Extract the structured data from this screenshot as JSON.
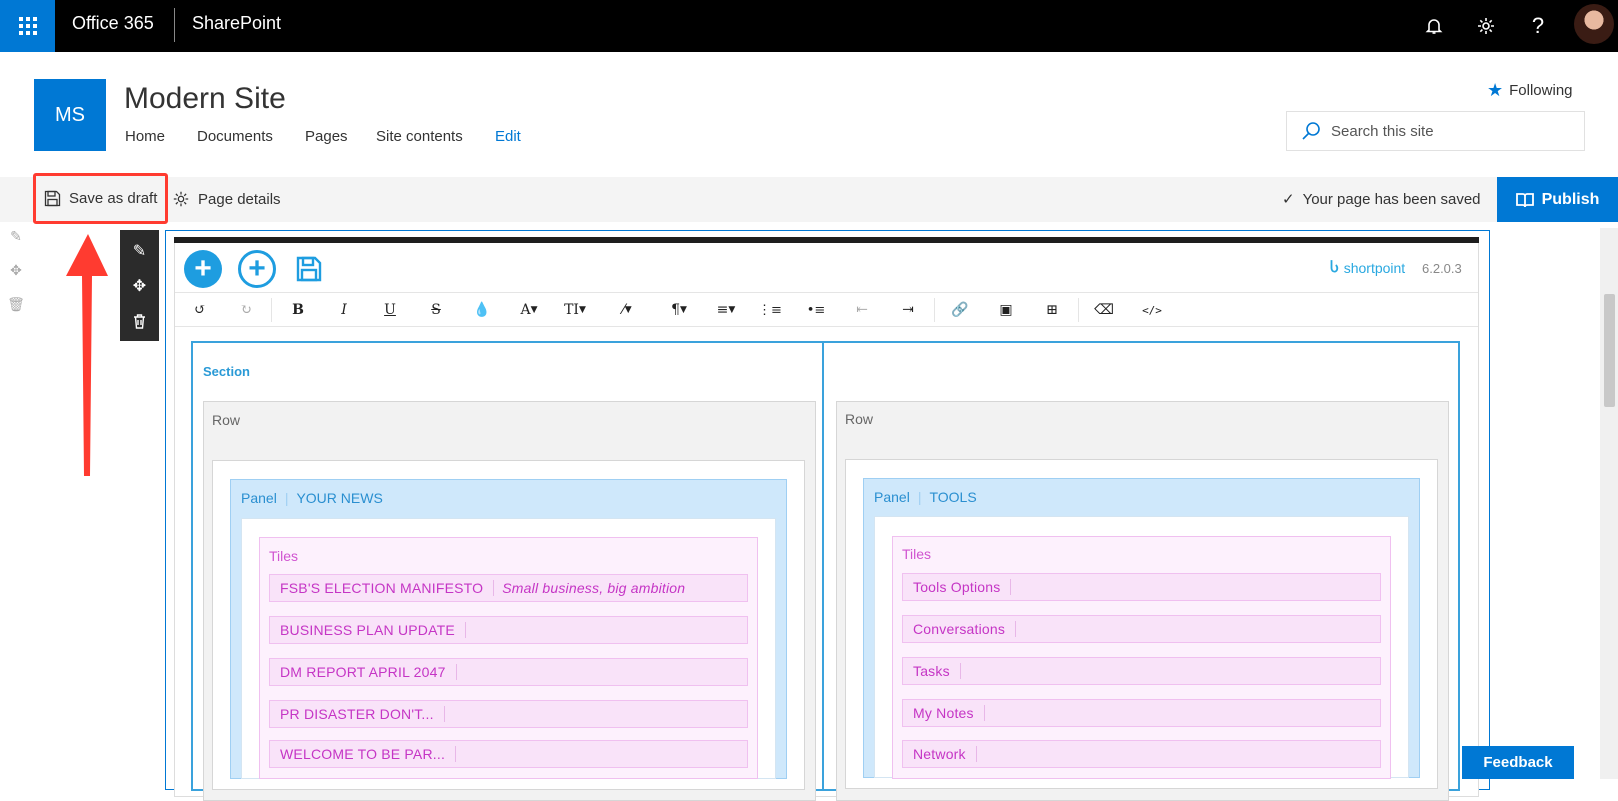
{
  "suite": {
    "app_name": "Office 365",
    "product": "SharePoint"
  },
  "site": {
    "logo_text": "MS",
    "title": "Modern Site",
    "nav": [
      "Home",
      "Documents",
      "Pages",
      "Site contents",
      "Edit"
    ],
    "follow_label": "Following",
    "search_placeholder": "Search this site"
  },
  "commandbar": {
    "save_draft": "Save as draft",
    "page_details": "Page details",
    "saved_message": "Your page has been saved",
    "publish": "Publish"
  },
  "editor": {
    "brand": "shortpoint",
    "version": "6.2.0.3",
    "section_label": "Section",
    "row_label": "Row",
    "left_panel": {
      "label": "Panel",
      "title": "YOUR NEWS"
    },
    "right_panel": {
      "label": "Panel",
      "title": "TOOLS"
    },
    "tiles_label": "Tiles",
    "left_tiles": [
      {
        "title": "FSB'S ELECTION MANIFESTO",
        "subtitle": "Small business, big ambition"
      },
      {
        "title": "BUSINESS PLAN UPDATE"
      },
      {
        "title": "DM REPORT APRIL 2047"
      },
      {
        "title": "PR DISASTER DON'T..."
      },
      {
        "title": "WELCOME TO BE PAR..."
      }
    ],
    "right_tiles": [
      {
        "title": "Tools Options"
      },
      {
        "title": "Conversations"
      },
      {
        "title": "Tasks"
      },
      {
        "title": "My Notes"
      },
      {
        "title": "Network"
      }
    ]
  },
  "feedback": "Feedback",
  "colors": {
    "accent": "#0078d4",
    "highlight": "#ff3b30",
    "tiles": "#c535c5"
  }
}
